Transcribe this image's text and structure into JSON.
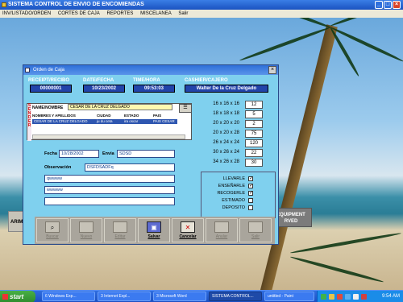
{
  "app": {
    "title": "SISTEMA CONTROL DE ENVIO DE ENCOMIENDAS",
    "menu": [
      "INV/LISTADO/ORDEN",
      "CORTES DE CAJA",
      "REPORTES",
      "MISCELANEA",
      "Salir"
    ]
  },
  "side_buttons": {
    "left": "ARIM",
    "right": "EQUIPMENT\nRVED"
  },
  "dialog": {
    "title": "Orden de Caja",
    "header": {
      "receipt_label": "RECEIPT/RECIBO",
      "receipt_value": "00000001",
      "date_label": "DATE/FECHA",
      "date_value": "10/23/2002",
      "time_label": "TIME/HORA",
      "time_value": "09:53:03",
      "cashier_label": "CASHIER/CAJERO",
      "cashier_value": "Walter De la Cruz Delgado"
    },
    "client": {
      "vertical_tag": "SENDER",
      "name_label": "NAME/NOMBRE",
      "name_value": "CESAR DE LA CRUZ DELGADO",
      "columns": [
        "NOMBRES Y APELLIDOS",
        "CIUDAD",
        "ESTADO",
        "PAIS"
      ],
      "row": [
        "CESAR DE LA CRUZ DELGADO",
        "ju du ceta",
        "ira oscar",
        "PAIS CESAR"
      ]
    },
    "fecha_label": "Fecha",
    "fecha_value": "10/28/2002",
    "envia_label": "Envia",
    "envia_value": "SDSD",
    "obs_label": "Observación",
    "obs_value": "DSFDSADFq",
    "line1": "qwwww",
    "line2": "wwwww",
    "line3": "",
    "sizes": [
      {
        "label": "16 x 16 x 16",
        "value": "12"
      },
      {
        "label": "18 x 18 x 18",
        "value": "5"
      },
      {
        "label": "20 x 20 x 20",
        "value": "2"
      },
      {
        "label": "20 x 20 x 28",
        "value": "75"
      },
      {
        "label": "26 x 24 x 24",
        "value": "120"
      },
      {
        "label": "30 x 26 x 24",
        "value": "22"
      },
      {
        "label": "34 x 26 x 28",
        "value": "30"
      }
    ],
    "options": [
      {
        "label": "LLEVARLE",
        "checked": "✓"
      },
      {
        "label": "ENSEÑARLE",
        "checked": "✓"
      },
      {
        "label": "RECOGERLE",
        "checked": "✓"
      },
      {
        "label": "ESTIMADO",
        "checked": ""
      },
      {
        "label": "DEPOSITO",
        "checked": ""
      }
    ],
    "toolbar": {
      "buscar": "Buscar",
      "nuevo": "Nuevo",
      "editar": "Editar",
      "salvar": "Salvar",
      "cancelar": "Cancelar",
      "anular": "Anular",
      "salir": "Salir"
    }
  },
  "taskbar": {
    "start": "start",
    "tasks": [
      "6 Windows Exp...",
      "3 Internet Expl...",
      "3 Microsoft Word",
      "SISTEMA CONTROL...",
      "untitled - Paint"
    ],
    "clock": "9:54 AM"
  },
  "colors": {
    "dialog_bg": "#7fd0ee",
    "header_box": "#2244aa",
    "name_highlight": "#fff8b0"
  }
}
